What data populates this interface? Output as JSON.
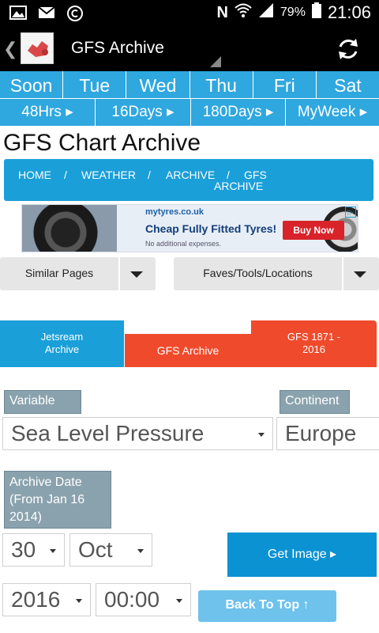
{
  "status_bar": {
    "battery": "79%",
    "time": "21:06"
  },
  "app_bar": {
    "title": "GFS Archive"
  },
  "day_tabs": [
    "Soon",
    "Tue",
    "Wed",
    "Thu",
    "Fri",
    "Sat"
  ],
  "range_tabs": [
    "48Hrs ▸",
    "16Days ▸",
    "180Days ▸",
    "MyWeek ▸"
  ],
  "page_title": "GFS Chart Archive",
  "breadcrumb": {
    "home": "HOME",
    "sep": "/",
    "weather": "WEATHER",
    "archive": "ARCHIVE",
    "gfs_line1": "GFS",
    "gfs_line2": "ARCHIVE"
  },
  "ad": {
    "site": "mytyres.co.uk",
    "headline": "Cheap Fully Fitted Tyres!",
    "subline": "No additional expenses.",
    "cta": "Buy Now",
    "choice_icon": "▷"
  },
  "dropdowns": {
    "similar_pages": "Similar Pages",
    "faves": "Faves/Tools/Locations"
  },
  "tabs": {
    "jetstream_line1": "Jetsream",
    "jetstream_line2": "Archive",
    "gfs_archive": "GFS Archive",
    "gfs_1871_line1": "GFS 1871 -",
    "gfs_1871_line2": "2016"
  },
  "form": {
    "variable_label": "Variable",
    "variable_value": "Sea Level Pressure",
    "continent_label": "Continent",
    "continent_value": "Europe",
    "archive_date_line1": "Archive Date",
    "archive_date_line2": "(From Jan 16",
    "archive_date_line3": "2014)",
    "day_value": "30",
    "month_value": "Oct",
    "year_value": "2016",
    "time_value": "00:00",
    "get_image_label": "Get Image ▸",
    "back_to_top_label": "Back To Top ↑"
  },
  "colors": {
    "tab_blue": "#2fa7df",
    "breadcrumb_blue": "#1a9fd9",
    "active_red": "#ef4a2c",
    "label_grey": "#8aa2ad",
    "btn_blue": "#0a92d3",
    "btn_light_blue": "#6ec2ec"
  }
}
